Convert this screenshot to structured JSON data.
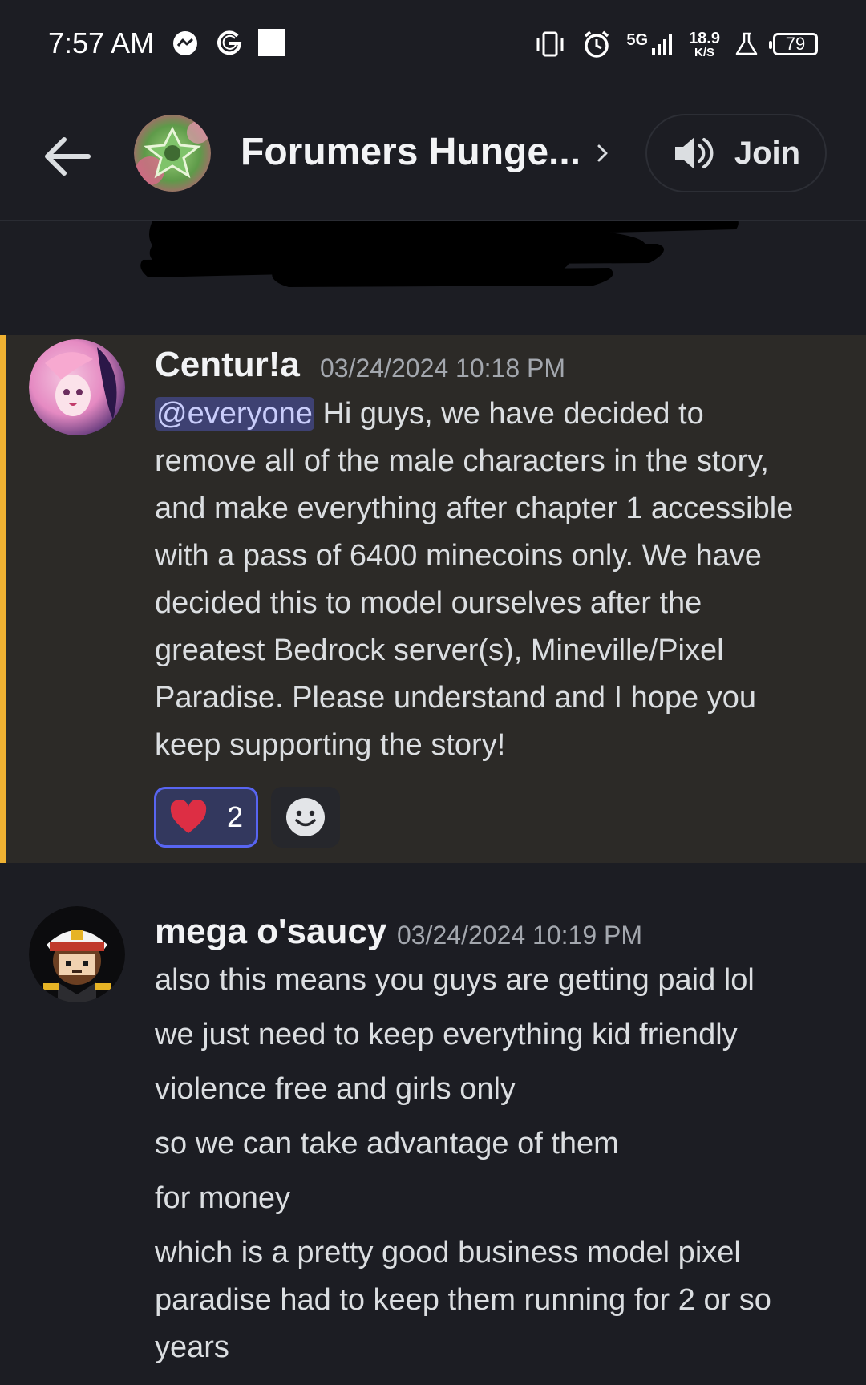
{
  "status_bar": {
    "time": "7:57 AM",
    "network_type": "5G",
    "net_speed_value": "18.9",
    "net_speed_unit": "K/S",
    "battery": "79"
  },
  "header": {
    "channel_title": "Forumers Hunge...",
    "join_label": "Join"
  },
  "messages": [
    {
      "author": "Centur!a",
      "timestamp": "03/24/2024 10:18 PM",
      "mention": "@everyone",
      "lines": [
        " Hi guys, we have decided to",
        "remove all of the male characters in the story,",
        "and make everything after chapter 1 accessible",
        "with a pass of 6400 minecoins only. We have",
        "decided this to model ourselves after the",
        "greatest Bedrock server(s), Mineville/Pixel",
        "Paradise. Please understand and I hope you",
        "keep supporting the story!"
      ],
      "reaction_count": "2"
    },
    {
      "author": "mega o'saucy",
      "timestamp": "03/24/2024 10:19 PM",
      "lines": [
        "also this means you guys are getting paid lol",
        "we just need to keep everything kid friendly",
        "violence free and girls only",
        "so we can take advantage of them",
        "for money",
        "which is a pretty good business model pixel",
        "paradise had to keep them running for 2 or so",
        "years"
      ]
    }
  ],
  "colors": {
    "background": "#1c1d23",
    "highlight_background": "#2c2a27",
    "highlight_border": "#f0b232",
    "mention_bg": "#3e4172",
    "reaction_border": "#5865f2"
  }
}
